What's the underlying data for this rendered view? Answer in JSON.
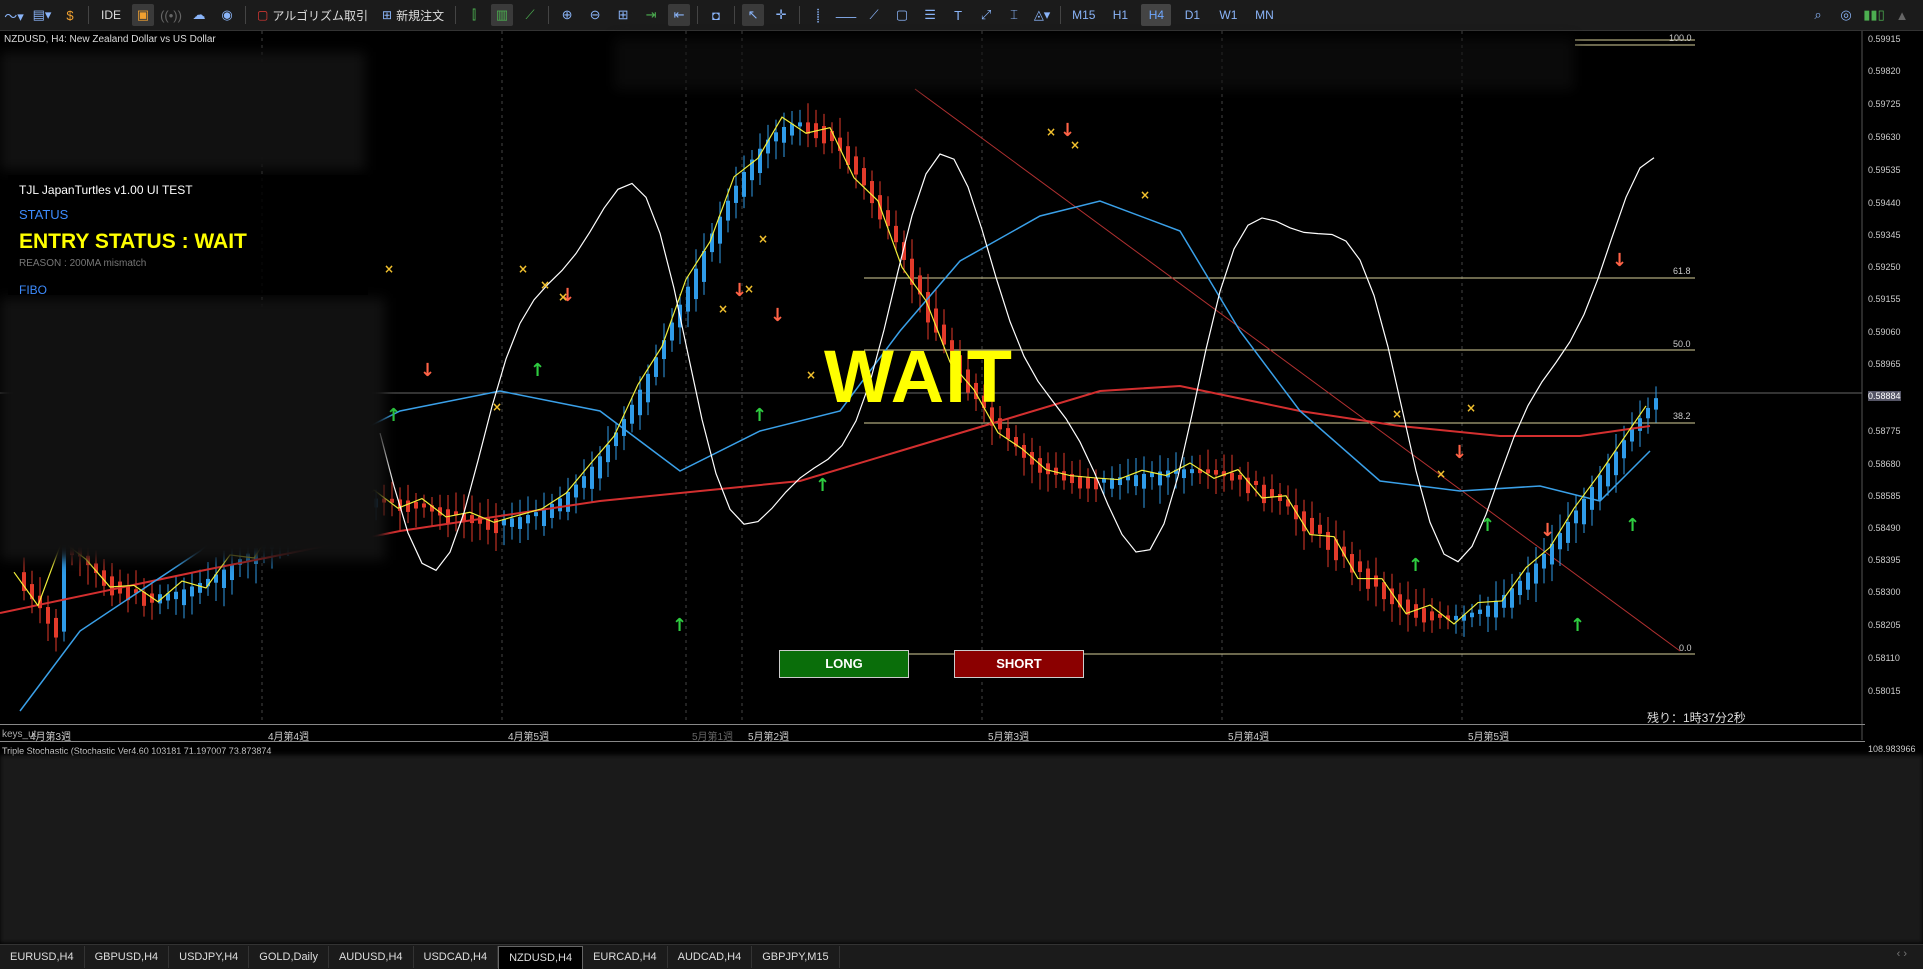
{
  "toolbar": {
    "ide": "IDE",
    "algo": "アルゴリズム取引",
    "new_order": "新規注文",
    "timeframes": [
      "M15",
      "H1",
      "H4",
      "D1",
      "W1",
      "MN"
    ],
    "active_timeframe": "H4"
  },
  "chart": {
    "symbol_line": "NZDUSD, H4:  New Zealand Dollar vs US Dollar",
    "panel": {
      "title": "TJL JapanTurtles v1.00 UI TEST",
      "status_label": "STATUS",
      "entry_status": "ENTRY STATUS : WAIT",
      "reason": "REASON : 200MA mismatch",
      "fibo_label": "FIBO"
    },
    "big_status": "WAIT",
    "long_button": "LONG",
    "short_button": "SHORT",
    "timer": "残り：1時37分2秒",
    "price_axis": [
      "0.59915",
      "0.59820",
      "0.59725",
      "0.59630",
      "0.59535",
      "0.59440",
      "0.59345",
      "0.59250",
      "0.59155",
      "0.59060",
      "0.58965",
      "0.58870",
      "0.58775",
      "0.58680",
      "0.58585",
      "0.58490",
      "0.58395",
      "0.58300",
      "0.58205",
      "0.58110",
      "0.58015"
    ],
    "current_price": "0.58884",
    "fib_levels": [
      "100.0",
      "61.8",
      "50.0",
      "38.2",
      "0.0"
    ],
    "time_axis": [
      "4月第3週",
      "4月第4週",
      "4月第5週",
      "5月第1週",
      "5月第2週",
      "5月第3週",
      "5月第4週",
      "5月第5週"
    ],
    "keys_label": "keys_ut",
    "stochastic_label": "Triple Stochastic (Stochastic Ver4.60 103181 71.197007 73.873874",
    "stochastic_value": "108.983966"
  },
  "tabs": [
    "EURUSD,H4",
    "GBPUSD,H4",
    "USDJPY,H4",
    "GOLD,Daily",
    "AUDUSD,H4",
    "USDCAD,H4",
    "NZDUSD,H4",
    "EURCAD,H4",
    "AUDCAD,H4",
    "GBPJPY,M15"
  ],
  "active_tab": "NZDUSD,H4",
  "colors": {
    "yellow": "#ffff00",
    "long": "#0a6e0a",
    "short": "#8b0000",
    "ma200": "#d32f2f",
    "ma_blue": "#3aa0e8"
  }
}
